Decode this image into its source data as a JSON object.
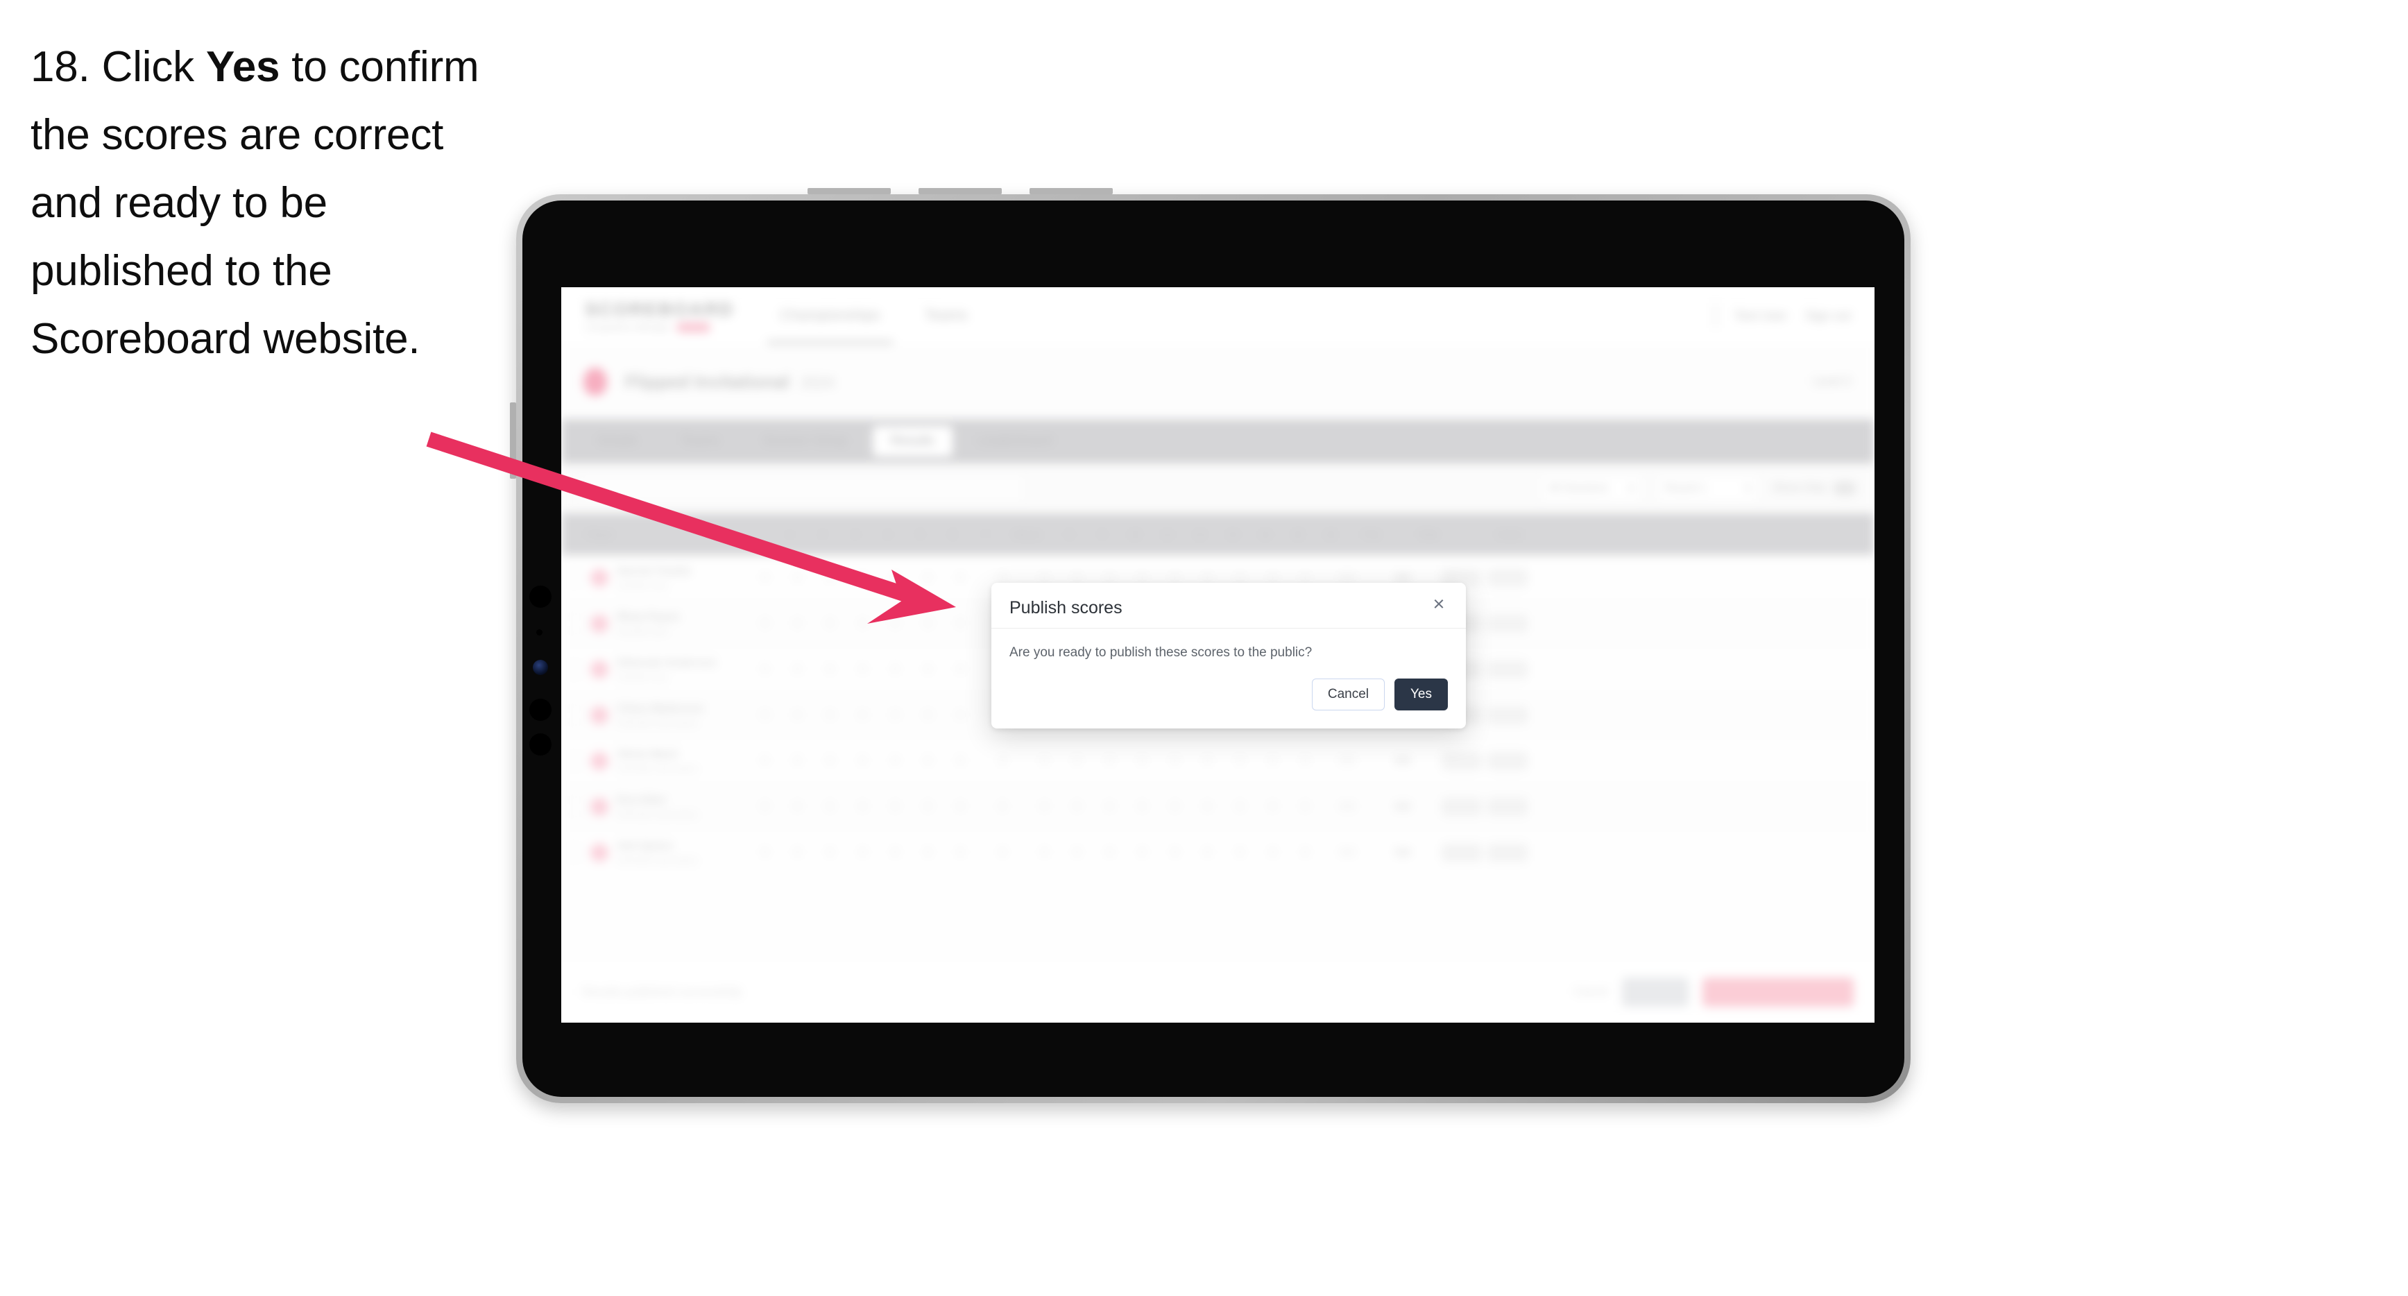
{
  "instruction": {
    "step_number": "18.",
    "text_before": " Click ",
    "emphasis": "Yes",
    "text_after": " to confirm the scores are correct and ready to be published to the Scoreboard website."
  },
  "colors": {
    "arrow": "#e8305f",
    "primary_button": "#2b3647",
    "accent_pink": "#f05a80",
    "device_bezel": "#b4b4b4",
    "screen_black": "#090909"
  },
  "modal": {
    "title": "Publish scores",
    "message": "Are you ready to publish these scores to the public?",
    "close_label": "×",
    "cancel_label": "Cancel",
    "confirm_label": "Yes"
  },
  "app": {
    "brand": {
      "name": "SCOREBOARD",
      "subtitle": "Competition Manager",
      "chip": "Beta"
    },
    "nav": [
      {
        "label": "Championships"
      },
      {
        "label": "Teams"
      }
    ],
    "header_right": [
      {
        "label": "Test User"
      },
      {
        "label": "Sign out"
      }
    ],
    "event": {
      "title": "Flipped Invitational",
      "year": "2024",
      "subtitle": "Artistic Gymnastics",
      "right_label": "Level 3"
    },
    "tabs": [
      {
        "label": "Details"
      },
      {
        "label": "Teams"
      },
      {
        "label": "Session Setup"
      },
      {
        "label": "Results"
      },
      {
        "label": "Leaderboard"
      }
    ],
    "active_tab": "Results",
    "filters": {
      "search_placeholder": "Search",
      "selects": [
        {
          "label": "All Sessions"
        },
        {
          "label": "Round 1"
        }
      ],
      "toggle_label": "Show Only"
    },
    "table": {
      "columns": [
        "Player",
        "1",
        "2",
        "3",
        "4",
        "5",
        "6",
        "7",
        "Bonus",
        "8",
        "9",
        "10",
        "11",
        "12",
        "13",
        "14",
        "15",
        "16",
        "Pen",
        "Total",
        "Action"
      ],
      "rows": [
        {
          "name": "Harriet Tomlin",
          "club": "Eastside Gym",
          "scores": [
            "0",
            "0",
            "0",
            "0",
            "0",
            "0",
            "0",
            "0",
            "0",
            "0",
            "0",
            "0",
            "0",
            "0",
            "0",
            "0",
            "0"
          ],
          "penalty": "0.0",
          "total": "0.0"
        },
        {
          "name": "Rhea Payne",
          "club": "Eastside Gym",
          "scores": [
            "0",
            "0",
            "0",
            "0",
            "0",
            "0",
            "0",
            "0",
            "0",
            "0",
            "0",
            "0",
            "0",
            "0",
            "0",
            "0",
            "0"
          ],
          "penalty": "0.0",
          "total": "0.0"
        },
        {
          "name": "Deborah Anderson",
          "club": "Eastside Gym",
          "scores": [
            "0",
            "0",
            "0",
            "0",
            "0",
            "0",
            "0",
            "0",
            "0",
            "0",
            "0",
            "0",
            "0",
            "0",
            "0",
            "0",
            "0"
          ],
          "penalty": "0.0",
          "total": "0.0"
        },
        {
          "name": "Chloe Matterson",
          "club": "Northside Gymnastics",
          "scores": [
            "0",
            "0",
            "0",
            "0",
            "0",
            "0",
            "0",
            "0",
            "0",
            "0",
            "0",
            "0",
            "0",
            "0",
            "0",
            "0",
            "0"
          ],
          "penalty": "0.0",
          "total": "0.0"
        },
        {
          "name": "Olivia Ward",
          "club": "Northside Gymnastics",
          "scores": [
            "0",
            "0",
            "0",
            "0",
            "0",
            "0",
            "0",
            "0",
            "0",
            "0",
            "0",
            "0",
            "0",
            "0",
            "0",
            "0",
            "0"
          ],
          "penalty": "0.0",
          "total": "0.0"
        },
        {
          "name": "Eva Allen",
          "club": "Northside Gymnastics",
          "scores": [
            "0",
            "0",
            "0",
            "0",
            "0",
            "0",
            "0",
            "0",
            "0",
            "0",
            "0",
            "0",
            "0",
            "0",
            "0",
            "0",
            "0"
          ],
          "penalty": "0.0",
          "total": "0.0"
        },
        {
          "name": "Ash Quinn",
          "club": "Northside Gymnastics",
          "scores": [
            "0",
            "0",
            "0",
            "0",
            "0",
            "0",
            "0",
            "0",
            "0",
            "0",
            "0",
            "0",
            "0",
            "0",
            "0",
            "0",
            "0"
          ],
          "penalty": "0.0",
          "total": "0.0"
        }
      ]
    },
    "footer": {
      "note": "Results published successfully",
      "link_label": "Cancel",
      "secondary_button": "Save All",
      "primary_button": "Publish to Scoreboard"
    }
  }
}
